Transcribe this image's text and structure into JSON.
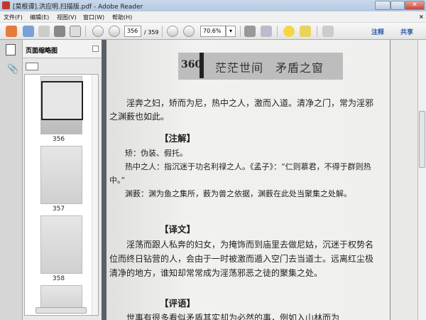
{
  "window": {
    "title": "[菜根谭].洪应明.扫描版.pdf - Adobe Reader"
  },
  "menu": [
    "文件(F)",
    "编辑(E)",
    "视图(V)",
    "窗口(W)",
    "帮助(H)"
  ],
  "toolbar": {
    "page_current": "356",
    "page_total": "/ 359",
    "zoom": "70.6%",
    "comment_label": "注释",
    "share_label": "共享"
  },
  "sidebar": {
    "title": "页面缩略图",
    "thumbnails": [
      {
        "label": "356"
      },
      {
        "label": "357"
      },
      {
        "label": "358"
      }
    ]
  },
  "document": {
    "page_number": "360",
    "header_title": "茫茫世间　矛盾之窗",
    "paragraphs": {
      "main": "　　淫奔之妇，矫而为尼，热中之人，激而入道。清净之门，常为淫邪之渊薮也如此。",
      "note_heading": "【注解】",
      "note1": "　　矫：伪装、假托。",
      "note2": "　　热中之人：指沉迷于功名利禄之人。《孟子》：“仁则慕君，不得于群则热中。”",
      "note3": "　　渊薮：渊为鱼之集所，薮为兽之依据，渊薮在此处当聚集之处解。",
      "trans_heading": "【译文】",
      "trans": "　　淫荡而跟人私奔的妇女，为掩饰而到庙里去做尼姑，沉迷于权势名位而终日钻营的人，会由于一时被激而遁入空门去当道士。远离红尘极清净的地方，谁知却常常成为淫荡邪恶之徒的聚集之处。",
      "comment_heading": "【评语】",
      "comment": "　　世事有很多看似矛盾其实却为必然的事，例如入山林而为"
    }
  },
  "colors": {
    "link": "#2a5aa8",
    "close": "#c9463d"
  }
}
